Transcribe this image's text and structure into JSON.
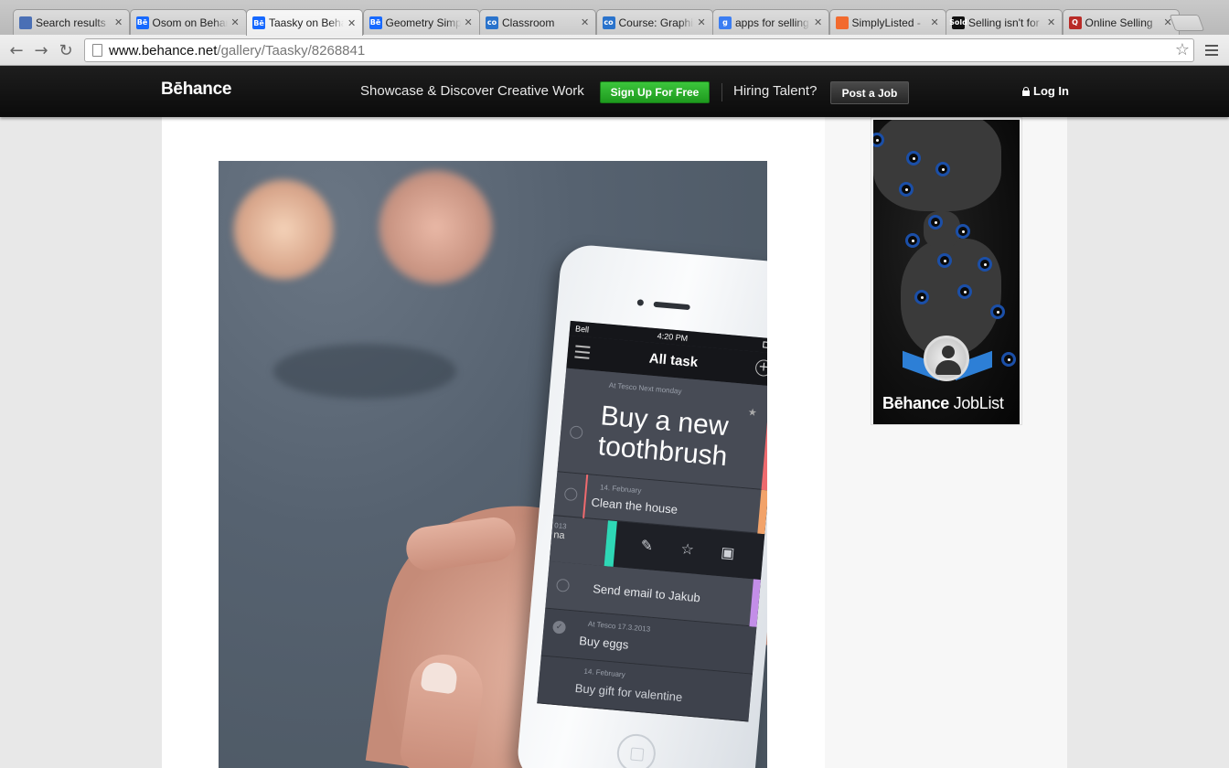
{
  "browser": {
    "tabs": [
      {
        "title": "Search results",
        "favicon": "behance-search-icon",
        "color": "#4a6fb5",
        "glyph": ""
      },
      {
        "title": "Osom on Behance",
        "favicon": "behance-icon",
        "color": "#1769ff",
        "glyph": "Bē"
      },
      {
        "title": "Taasky on Behance",
        "favicon": "behance-icon",
        "color": "#1769ff",
        "glyph": "Bē",
        "active": true
      },
      {
        "title": "Geometry Simple",
        "favicon": "behance-icon",
        "color": "#1769ff",
        "glyph": "Bē"
      },
      {
        "title": "Classroom",
        "favicon": "coursera-icon",
        "color": "#2a73cc",
        "glyph": "co"
      },
      {
        "title": "Course: Graphic",
        "favicon": "coursera-icon",
        "color": "#2a73cc",
        "glyph": "co"
      },
      {
        "title": "apps for selling",
        "favicon": "google-icon",
        "color": "#3b7df2",
        "glyph": "g"
      },
      {
        "title": "SimplyListed - ",
        "favicon": "tag-icon",
        "color": "#f26a2e",
        "glyph": ""
      },
      {
        "title": "Selling isn't for",
        "favicon": "sold-icon",
        "color": "#111111",
        "glyph": "Sold"
      },
      {
        "title": "Online Selling",
        "favicon": "quora-icon",
        "color": "#b92b27",
        "glyph": "Q"
      }
    ],
    "url_host": "www.behance.net",
    "url_path": "/gallery/Taasky/8268841"
  },
  "behance": {
    "logo": "Bēhance",
    "tagline": "Showcase & Discover Creative Work",
    "signup_label": "Sign Up For Free",
    "hiring_label": "Hiring Talent?",
    "post_job_label": "Post a Job",
    "login_label": "Log In"
  },
  "project_image": {
    "status": {
      "carrier": "Bell",
      "time": "4:20 PM"
    },
    "app_title": "All task",
    "tasks": [
      {
        "meta": "At Tesco   Next monday",
        "label": "Buy a new toothbrush"
      },
      {
        "meta": "14. February",
        "label": "Clean the house"
      },
      {
        "meta": "013",
        "label": "na"
      },
      {
        "meta": "",
        "label": "Send email to Jakub"
      },
      {
        "meta": "At Tesco   17.3.2013",
        "label": "Buy eggs"
      },
      {
        "meta": "14. February",
        "label": "Buy gift for valentine"
      }
    ]
  },
  "ad": {
    "brand_bold": "Bēhance",
    "brand_light": "JobList"
  }
}
